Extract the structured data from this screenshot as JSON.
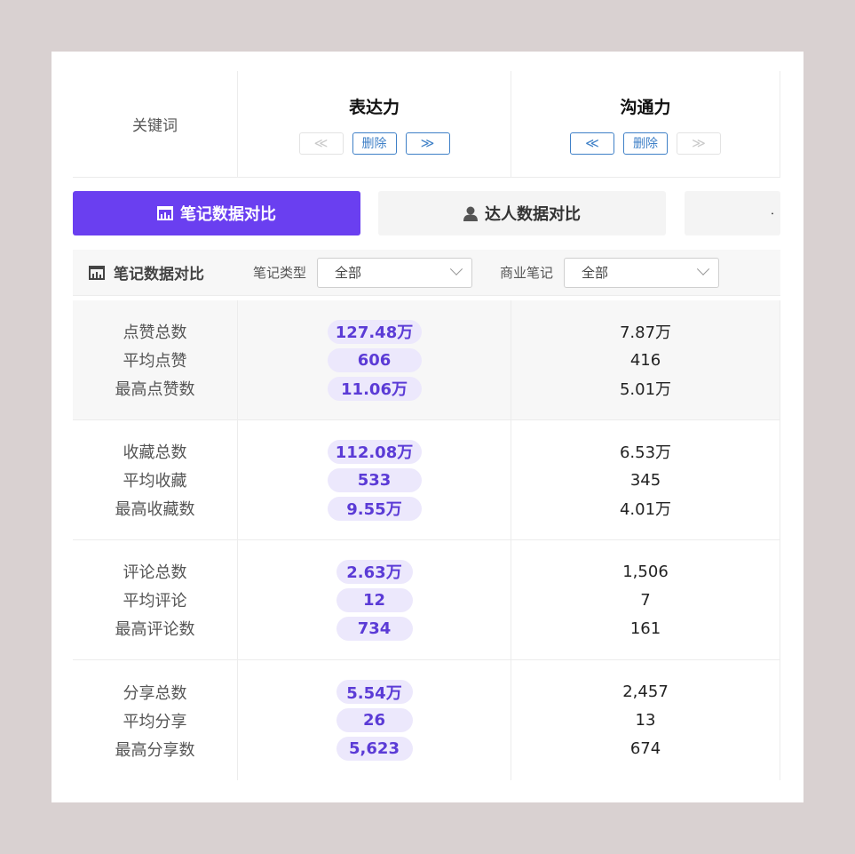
{
  "keywords": {
    "label": "关键词",
    "columns": [
      {
        "title": "表达力",
        "prev": "≪",
        "delete": "删除",
        "next": "≫",
        "prev_disabled": true,
        "next_disabled": false
      },
      {
        "title": "沟通力",
        "prev": "≪",
        "delete": "删除",
        "next": "≫",
        "prev_disabled": false,
        "next_disabled": true
      }
    ]
  },
  "tabs": [
    {
      "label": "笔记数据对比",
      "icon": "chart-icon",
      "active": true
    },
    {
      "label": "达人数据对比",
      "icon": "user-icon",
      "active": false
    },
    {
      "label": "",
      "icon": "lock-icon",
      "active": false
    }
  ],
  "filter": {
    "title": "笔记数据对比",
    "note_type_label": "笔记类型",
    "note_type_value": "全部",
    "business_label": "商业笔记",
    "business_value": "全部"
  },
  "groups": [
    {
      "labels": [
        "点赞总数",
        "平均点赞",
        "最高点赞数"
      ],
      "col1": [
        "127.48万",
        "606",
        "11.06万"
      ],
      "col2": [
        "7.87万",
        "416",
        "5.01万"
      ]
    },
    {
      "labels": [
        "收藏总数",
        "平均收藏",
        "最高收藏数"
      ],
      "col1": [
        "112.08万",
        "533",
        "9.55万"
      ],
      "col2": [
        "6.53万",
        "345",
        "4.01万"
      ]
    },
    {
      "labels": [
        "评论总数",
        "平均评论",
        "最高评论数"
      ],
      "col1": [
        "2.63万",
        "12",
        "734"
      ],
      "col2": [
        "1,506",
        "7",
        "161"
      ]
    },
    {
      "labels": [
        "分享总数",
        "平均分享",
        "最高分享数"
      ],
      "col1": [
        "5.54万",
        "26",
        "5,623"
      ],
      "col2": [
        "2,457",
        "13",
        "674"
      ]
    }
  ],
  "colors": {
    "accent": "#6a3ff0",
    "pill_bg": "#ece8fc",
    "pill_text": "#5b3bd6",
    "button_blue": "#3f80c7"
  }
}
